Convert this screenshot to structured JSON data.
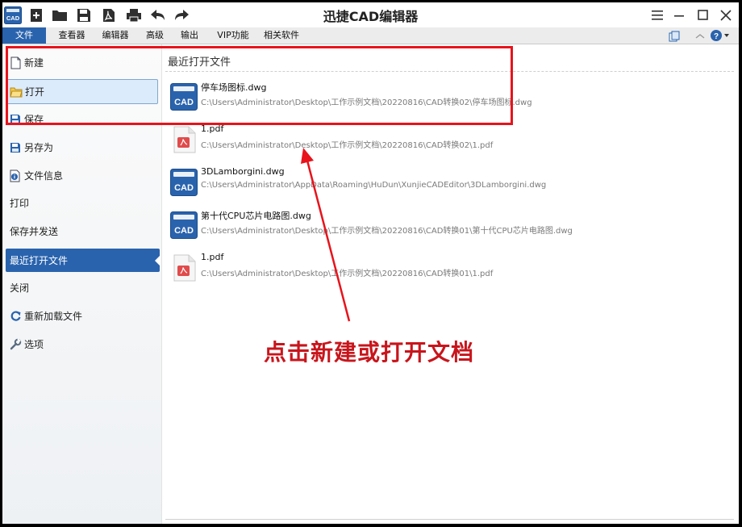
{
  "app": {
    "title": "迅捷CAD编辑器",
    "logo_text": "CAD",
    "quick_access": [
      "new-file-icon",
      "open-folder-icon",
      "save-disk-icon",
      "export-pdf-icon",
      "print-icon",
      "undo-icon",
      "redo-icon"
    ],
    "window_controls": [
      "menu-icon",
      "minimize-icon",
      "maximize-icon",
      "close-icon"
    ]
  },
  "menubar": {
    "items": [
      "文件",
      "查看器",
      "编辑器",
      "高级",
      "输出",
      "VIP功能",
      "相关软件"
    ],
    "active": "文件"
  },
  "sidebar": {
    "items": [
      {
        "label": "新建",
        "icon": "new-document-icon"
      },
      {
        "label": "打开",
        "icon": "open-folder-icon"
      },
      {
        "label": "保存",
        "icon": "save-disk-icon"
      },
      {
        "label": "另存为",
        "icon": "save-as-icon"
      },
      {
        "label": "文件信息",
        "icon": "file-info-icon"
      },
      {
        "label": "打印",
        "icon": ""
      },
      {
        "label": "保存并发送",
        "icon": ""
      },
      {
        "label": "最近打开文件",
        "icon": ""
      },
      {
        "label": "关闭",
        "icon": ""
      },
      {
        "label": "重新加载文件",
        "icon": "reload-icon"
      },
      {
        "label": "选项",
        "icon": "wrench-icon"
      }
    ],
    "selected": "最近打开文件",
    "hovered": "打开"
  },
  "recent": {
    "title": "最近打开文件",
    "files": [
      {
        "name": "停车场图标.dwg",
        "path": "C:\\Users\\Administrator\\Desktop\\工作示例文档\\20220816\\CAD转换02\\停车场图标.dwg",
        "type": "dwg",
        "icon_text": "CAD"
      },
      {
        "name": "1.pdf",
        "path": "C:\\Users\\Administrator\\Desktop\\工作示例文档\\20220816\\CAD转换02\\1.pdf",
        "type": "pdf"
      },
      {
        "name": "3DLamborgini.dwg",
        "path": "C:\\Users\\Administrator\\AppData\\Roaming\\HuDun\\XunjieCADEditor\\3DLamborgini.dwg",
        "type": "dwg",
        "icon_text": "CAD"
      },
      {
        "name": "第十代CPU芯片电路图.dwg",
        "path": "C:\\Users\\Administrator\\Desktop\\工作示例文档\\20220816\\CAD转换01\\第十代CPU芯片电路图.dwg",
        "type": "dwg",
        "icon_text": "CAD"
      },
      {
        "name": "1.pdf",
        "path": "C:\\Users\\Administrator\\Desktop\\工作示例文档\\20220816\\CAD转换01\\1.pdf",
        "type": "pdf"
      }
    ]
  },
  "annotation": {
    "text": "点击新建或打开文档",
    "color": "#c8151c"
  },
  "colors": {
    "accent": "#2a63ad",
    "highlight_box": "#e8131b",
    "cad_icon": "#2a63ad"
  }
}
